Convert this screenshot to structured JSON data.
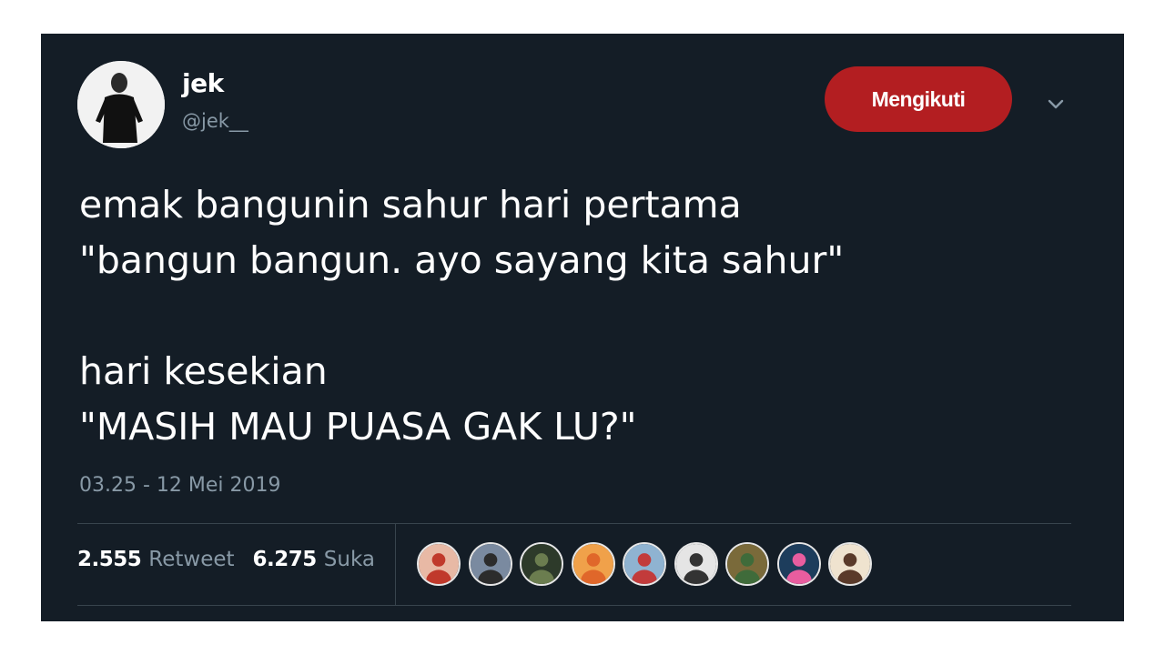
{
  "tweet": {
    "author": {
      "display_name": "jek",
      "handle": "@jek__"
    },
    "follow_button_label": "Mengikuti",
    "text_lines": [
      "emak bangunin sahur hari pertama",
      "\"bangun bangun. ayo sayang kita sahur\"",
      "",
      "hari kesekian",
      "\"MASIH MAU PUASA GAK LU?\""
    ],
    "timestamp": "03.25 - 12 Mei 2019",
    "stats": {
      "retweets": "2.555",
      "retweets_label": "Retweet",
      "likes": "6.275",
      "likes_label": "Suka"
    },
    "liker_avatars": [
      {
        "bg": "#e8b9a5",
        "fg": "#c0392b"
      },
      {
        "bg": "#7a8aa0",
        "fg": "#2c2c2c"
      },
      {
        "bg": "#2d3a2a",
        "fg": "#6b7d4f"
      },
      {
        "bg": "#f0a14a",
        "fg": "#e0672a"
      },
      {
        "bg": "#8fb3d1",
        "fg": "#c23b3b"
      },
      {
        "bg": "#e5e5e5",
        "fg": "#333333"
      },
      {
        "bg": "#7a6a3a",
        "fg": "#3f6b3a"
      },
      {
        "bg": "#1d3d5c",
        "fg": "#e85d9f"
      },
      {
        "bg": "#efe3cf",
        "fg": "#5a3a2a"
      }
    ],
    "colors": {
      "background": "#141d26",
      "follow_button": "#b31e21",
      "secondary_text": "#8899a6"
    }
  }
}
